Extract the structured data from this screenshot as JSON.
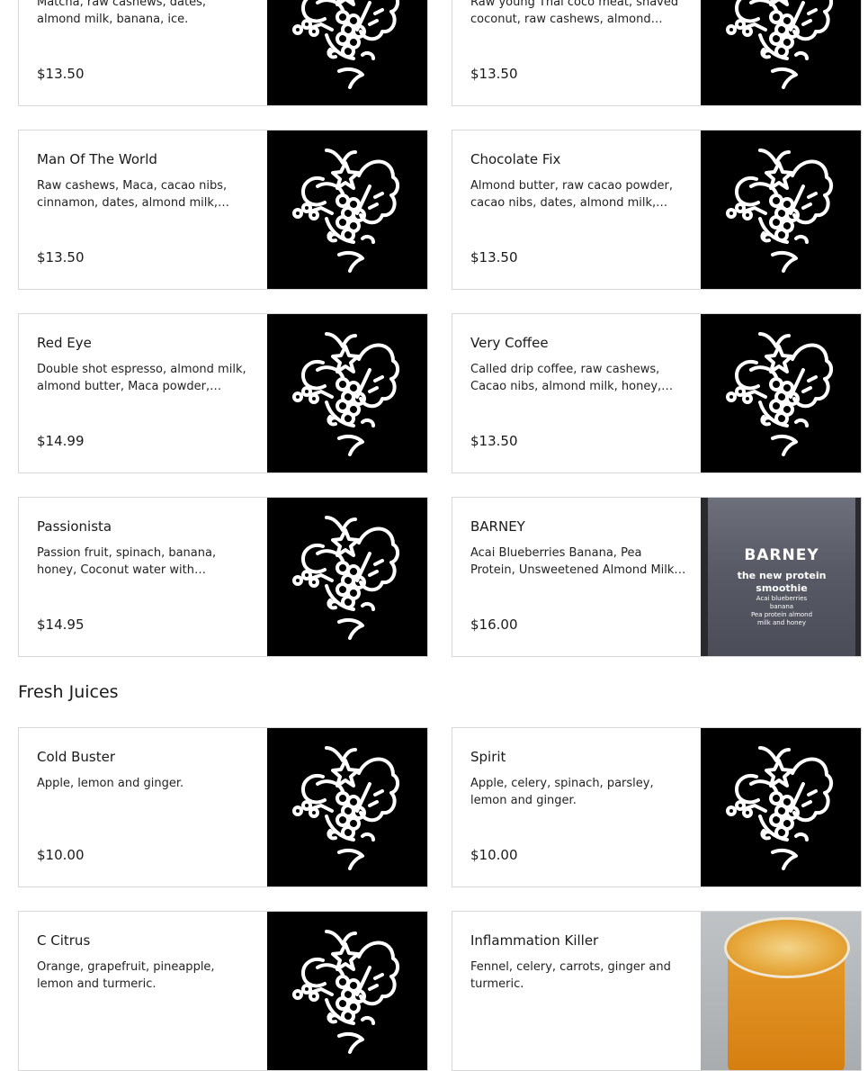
{
  "sections": [
    {
      "items": [
        {
          "name": "",
          "description": "Matcha, raw cashews, dates, almond milk, banana, ice.",
          "price": "$13.50",
          "image": "logo"
        },
        {
          "name": "",
          "description": "Raw young Thai coco meat, shaved coconut, raw cashews, almond milk,…",
          "price": "$13.50",
          "image": "logo"
        },
        {
          "name": "Man Of The World",
          "description": "Raw cashews, Maca, cacao nibs, cinnamon, dates, almond milk,…",
          "price": "$13.50",
          "image": "logo"
        },
        {
          "name": "Chocolate Fix",
          "description": "Almond butter, raw cacao powder, cacao nibs, dates, almond milk,…",
          "price": "$13.50",
          "image": "logo"
        },
        {
          "name": "Red Eye",
          "description": "Double shot espresso, almond milk, almond butter, Maca powder, cacao…",
          "price": "$14.99",
          "image": "logo"
        },
        {
          "name": "Very Coffee",
          "description": "Called drip coffee, raw cashews, Cacao nibs, almond milk, honey,…",
          "price": "$13.50",
          "image": "logo"
        },
        {
          "name": "Passionista",
          "description": "Passion fruit, spinach, banana, honey, Coconut water with Strawberry hone…",
          "price": "$14.95",
          "image": "logo"
        },
        {
          "name": "BARNEY",
          "description": "Acai Blueberries Banana, Pea Protein, Unsweetened Almond Milk, Honey",
          "price": "$16.00",
          "image": "barney-photo"
        }
      ]
    },
    {
      "title": "Fresh Juices",
      "items": [
        {
          "name": "Cold Buster",
          "description": "Apple, lemon and ginger.",
          "price": "$10.00",
          "image": "logo"
        },
        {
          "name": "Spirit",
          "description": "Apple, celery, spinach, parsley, lemon and ginger.",
          "price": "$10.00",
          "image": "logo"
        },
        {
          "name": "C Citrus",
          "description": "Orange, grapefruit, pineapple, lemon and turmeric.",
          "price": "",
          "image": "logo"
        },
        {
          "name": "Inflammation Killer",
          "description": "Fennel, celery, carrots, ginger and turmeric.",
          "price": "",
          "image": "juice-photo"
        }
      ]
    }
  ],
  "barney_photo_text": {
    "line1": "BARNEY",
    "line2": "the new protein",
    "line3": "smoothie",
    "line4": "Acai blueberries",
    "line5": "banana",
    "line6": "Pea protein almond",
    "line7": "milk and honey"
  }
}
